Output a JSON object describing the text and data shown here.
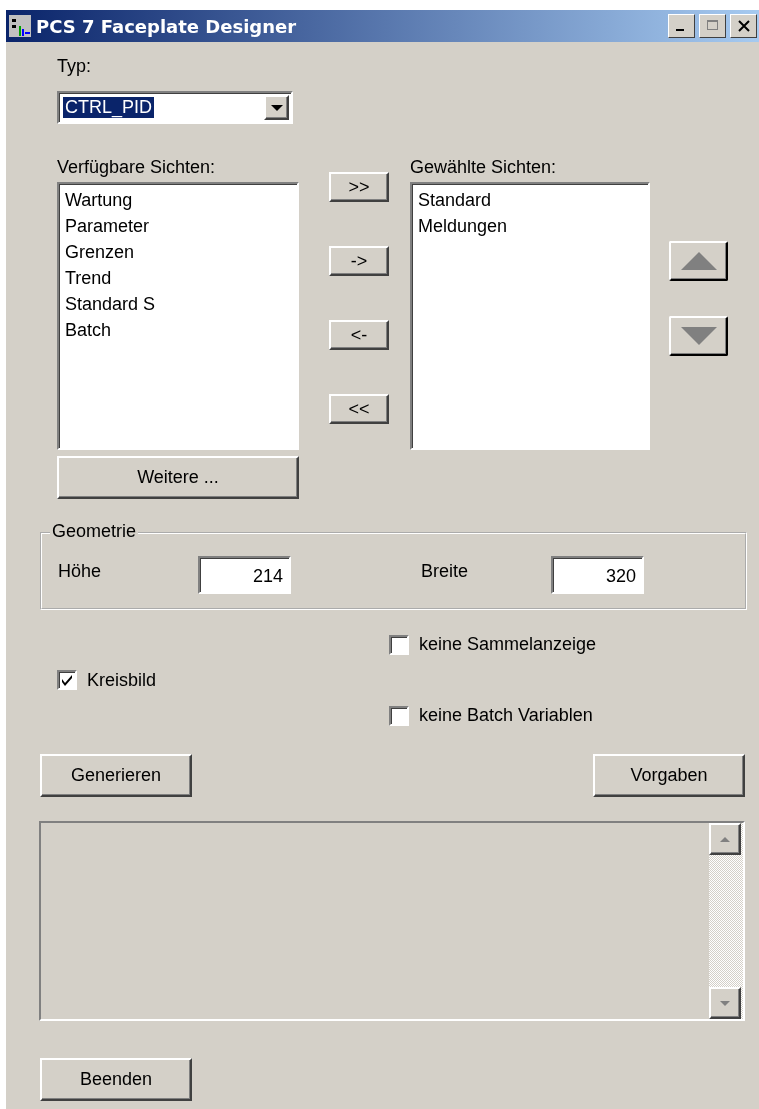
{
  "window": {
    "title": "PCS 7 Faceplate Designer"
  },
  "type_field": {
    "label": "Typ:",
    "value": "CTRL_PID"
  },
  "available": {
    "label": "Verfügbare Sichten:",
    "items": [
      "Wartung",
      "Parameter",
      "Grenzen",
      "Trend",
      "Standard S",
      "Batch"
    ]
  },
  "transfer_buttons": [
    ">>",
    "->",
    "<-",
    "<<"
  ],
  "selected_views": {
    "label": "Gewählte Sichten:",
    "items": [
      "Standard",
      "Meldungen"
    ]
  },
  "more_button": "Weitere ...",
  "geometry": {
    "title": "Geometrie",
    "fields": [
      {
        "label": "Höhe",
        "value": "214"
      },
      {
        "label": "Breite",
        "value": "320"
      }
    ]
  },
  "options": [
    {
      "label": "Kreisbild",
      "checked": true
    },
    {
      "label": "keine Sammelanzeige",
      "checked": false
    },
    {
      "label": "keine Batch Variablen",
      "checked": false
    }
  ],
  "buttons": [
    "Generieren",
    "Vorgaben"
  ],
  "close_button": "Beenden"
}
